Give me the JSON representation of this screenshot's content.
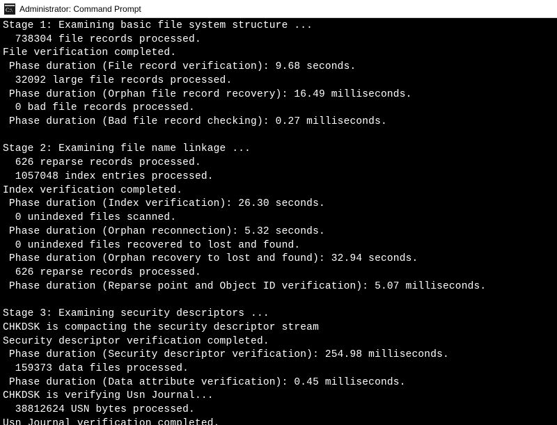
{
  "titlebar": {
    "title": "Administrator: Command Prompt"
  },
  "terminal": {
    "lines": [
      "Stage 1: Examining basic file system structure ...",
      "  738304 file records processed.",
      "File verification completed.",
      " Phase duration (File record verification): 9.68 seconds.",
      "  32092 large file records processed.",
      " Phase duration (Orphan file record recovery): 16.49 milliseconds.",
      "  0 bad file records processed.",
      " Phase duration (Bad file record checking): 0.27 milliseconds.",
      "",
      "Stage 2: Examining file name linkage ...",
      "  626 reparse records processed.",
      "  1057048 index entries processed.",
      "Index verification completed.",
      " Phase duration (Index verification): 26.30 seconds.",
      "  0 unindexed files scanned.",
      " Phase duration (Orphan reconnection): 5.32 seconds.",
      "  0 unindexed files recovered to lost and found.",
      " Phase duration (Orphan recovery to lost and found): 32.94 seconds.",
      "  626 reparse records processed.",
      " Phase duration (Reparse point and Object ID verification): 5.07 milliseconds.",
      "",
      "Stage 3: Examining security descriptors ...",
      "CHKDSK is compacting the security descriptor stream",
      "Security descriptor verification completed.",
      " Phase duration (Security descriptor verification): 254.98 milliseconds.",
      "  159373 data files processed.",
      " Phase duration (Data attribute verification): 0.45 milliseconds.",
      "CHKDSK is verifying Usn Journal...",
      "  38812624 USN bytes processed.",
      "Usn Journal verification completed."
    ]
  }
}
